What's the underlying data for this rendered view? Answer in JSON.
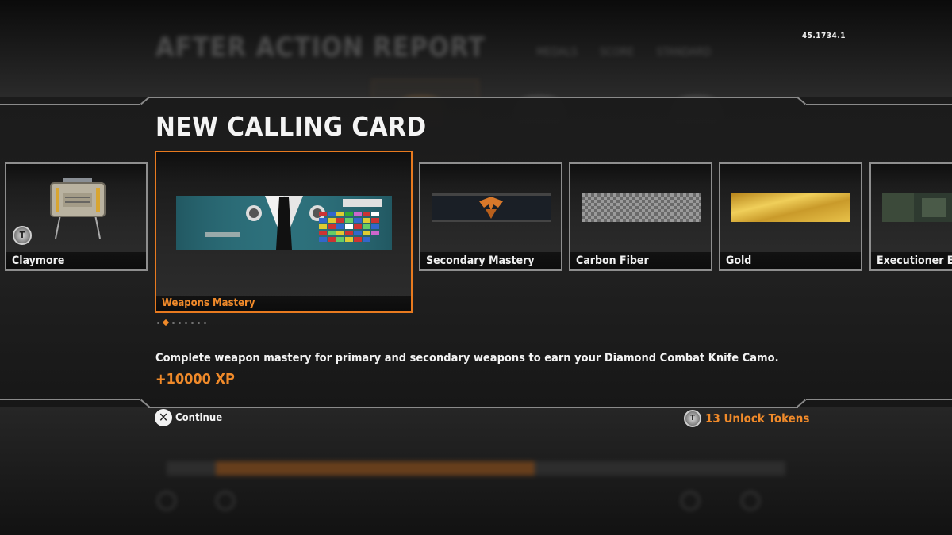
{
  "header": {
    "version": "45.1734.1",
    "title": "NEW CALLING CARD"
  },
  "background": {
    "title": "AFTER ACTION REPORT",
    "tabs": [
      "MEDALS",
      "SCORE",
      "STANDARD"
    ]
  },
  "cards": [
    {
      "label": "Claymore",
      "art": "claymore-icon",
      "has_token_icon": true
    },
    {
      "label": "Weapons Mastery",
      "art": "dress-uniform-calling-card",
      "selected": true
    },
    {
      "label": "Secondary Mastery",
      "art": "eagle-calling-card"
    },
    {
      "label": "Carbon Fiber",
      "art": "carbon-fiber-camo"
    },
    {
      "label": "Gold",
      "art": "gold-camo"
    },
    {
      "label": "Executioner Exp",
      "art": "executioner-calling-card"
    }
  ],
  "pager": {
    "count": 8,
    "active_index": 1
  },
  "description": "Complete weapon mastery for primary and secondary weapons to earn your Diamond Combat Knife Camo.",
  "reward": "+10000 XP",
  "footer": {
    "continue_glyph": "✕",
    "continue_label": "Continue",
    "token_glyph": "T",
    "unlock_tokens_label": "13 Unlock Tokens"
  },
  "colors": {
    "accent": "#f08a2a",
    "card_border": "#8e8e8e",
    "band": "#1e1e1e"
  }
}
